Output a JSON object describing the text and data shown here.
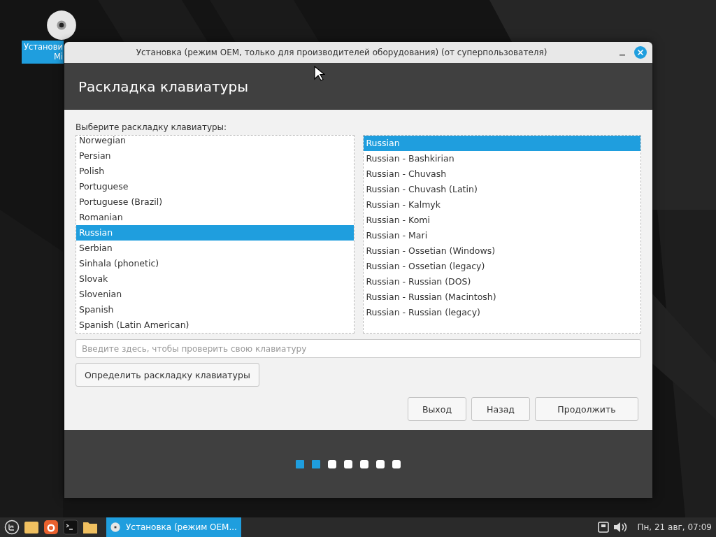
{
  "desktop_icon": {
    "label_lines": [
      "Установи",
      "Mi"
    ]
  },
  "window": {
    "title": "Установка (режим OEM, только для производителей оборудования) (от суперпользователя)"
  },
  "header": {
    "title": "Раскладка клавиатуры"
  },
  "layout_prompt": "Выберите раскладку клавиатуры:",
  "layouts": [
    {
      "label": "Norwegian",
      "selected": false
    },
    {
      "label": "Persian",
      "selected": false
    },
    {
      "label": "Polish",
      "selected": false
    },
    {
      "label": "Portuguese",
      "selected": false
    },
    {
      "label": "Portuguese (Brazil)",
      "selected": false
    },
    {
      "label": "Romanian",
      "selected": false
    },
    {
      "label": "Russian",
      "selected": true
    },
    {
      "label": "Serbian",
      "selected": false
    },
    {
      "label": "Sinhala (phonetic)",
      "selected": false
    },
    {
      "label": "Slovak",
      "selected": false
    },
    {
      "label": "Slovenian",
      "selected": false
    },
    {
      "label": "Spanish",
      "selected": false
    },
    {
      "label": "Spanish (Latin American)",
      "selected": false
    }
  ],
  "variants": [
    {
      "label": "Russian",
      "selected": true
    },
    {
      "label": "Russian - Bashkirian",
      "selected": false
    },
    {
      "label": "Russian - Chuvash",
      "selected": false
    },
    {
      "label": "Russian - Chuvash (Latin)",
      "selected": false
    },
    {
      "label": "Russian - Kalmyk",
      "selected": false
    },
    {
      "label": "Russian - Komi",
      "selected": false
    },
    {
      "label": "Russian - Mari",
      "selected": false
    },
    {
      "label": "Russian - Ossetian (Windows)",
      "selected": false
    },
    {
      "label": "Russian - Ossetian (legacy)",
      "selected": false
    },
    {
      "label": "Russian - Russian (DOS)",
      "selected": false
    },
    {
      "label": "Russian - Russian (Macintosh)",
      "selected": false
    },
    {
      "label": "Russian - Russian (legacy)",
      "selected": false
    }
  ],
  "test_field": {
    "placeholder": "Введите здесь, чтобы проверить свою клавиатуру"
  },
  "detect_button": "Определить раскладку клавиатуры",
  "buttons": [
    "Выход",
    "Назад",
    "Продолжить"
  ],
  "progress": [
    {
      "done": true
    },
    {
      "done": true
    },
    {
      "done": false
    },
    {
      "done": false
    },
    {
      "done": false
    },
    {
      "done": false
    },
    {
      "done": false
    }
  ],
  "taskbar": {
    "window_button": "Установка (режим OEM...",
    "clock": "Пн, 21 авг, 07:09"
  }
}
